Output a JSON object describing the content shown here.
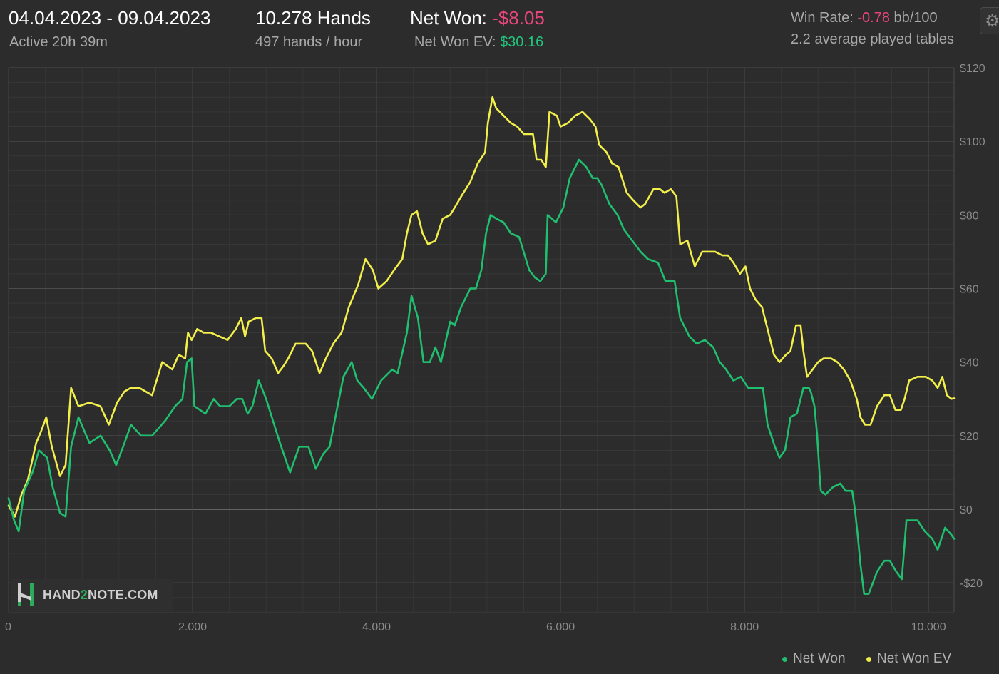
{
  "header": {
    "date_range": "04.04.2023 - 09.04.2023",
    "active": "Active 20h 39m",
    "hands_total": "10.278 Hands",
    "hands_rate": "497 hands / hour",
    "net_won_label": "Net Won: ",
    "net_won_value": "-$8.05",
    "net_won_ev_label": "Net Won  EV: ",
    "net_won_ev_value": "$30.16",
    "win_rate_label": "Win Rate: ",
    "win_rate_value": "-0.78",
    "win_rate_unit": " bb/100",
    "tables": "2.2 average played tables"
  },
  "settings_icon": "gear-icon",
  "logo": {
    "text_a": "HAND",
    "text_b": "2",
    "text_c": "NOTE.COM"
  },
  "colors": {
    "background": "#2c2c2c",
    "net_won": "#1fbf6f",
    "net_won_ev": "#f2ee4a",
    "negative": "#e8457a",
    "positive": "#22c57d",
    "grid": "#4a4a4a"
  },
  "chart_data": {
    "type": "line",
    "xlabel": "",
    "ylabel": "",
    "xlim": [
      0,
      10278
    ],
    "ylim": [
      -28,
      120
    ],
    "x_ticks": [
      0,
      2000,
      4000,
      6000,
      8000,
      10000
    ],
    "x_tick_labels": [
      "0",
      "2.000",
      "4.000",
      "6.000",
      "8.000",
      "10.000"
    ],
    "y_ticks": [
      120,
      100,
      80,
      60,
      40,
      20,
      0,
      -20
    ],
    "y_tick_labels": [
      "$120",
      "$100",
      "$80",
      "$60",
      "$40",
      "$20",
      "$0",
      "-$20"
    ],
    "grid": true,
    "legend_position": "bottom-right",
    "series": [
      {
        "name": "Net Won",
        "color": "#1fbf6f",
        "points": [
          [
            0,
            3
          ],
          [
            60,
            -3
          ],
          [
            110,
            -6
          ],
          [
            170,
            5
          ],
          [
            260,
            10
          ],
          [
            330,
            16
          ],
          [
            420,
            14
          ],
          [
            480,
            6
          ],
          [
            560,
            -1
          ],
          [
            620,
            -2
          ],
          [
            680,
            17
          ],
          [
            760,
            25
          ],
          [
            880,
            18
          ],
          [
            1000,
            20
          ],
          [
            1100,
            16
          ],
          [
            1170,
            12
          ],
          [
            1260,
            18
          ],
          [
            1330,
            23
          ],
          [
            1440,
            20
          ],
          [
            1560,
            20
          ],
          [
            1700,
            24
          ],
          [
            1810,
            28
          ],
          [
            1890,
            30
          ],
          [
            1940,
            40
          ],
          [
            1990,
            41
          ],
          [
            2020,
            28
          ],
          [
            2080,
            27
          ],
          [
            2140,
            26
          ],
          [
            2230,
            30
          ],
          [
            2300,
            28
          ],
          [
            2400,
            28
          ],
          [
            2480,
            30
          ],
          [
            2540,
            30
          ],
          [
            2600,
            26
          ],
          [
            2650,
            28
          ],
          [
            2720,
            35
          ],
          [
            2800,
            30
          ],
          [
            2900,
            22
          ],
          [
            2950,
            18
          ],
          [
            3060,
            10
          ],
          [
            3160,
            17
          ],
          [
            3260,
            17
          ],
          [
            3340,
            11
          ],
          [
            3420,
            15
          ],
          [
            3490,
            17
          ],
          [
            3560,
            26
          ],
          [
            3640,
            36
          ],
          [
            3730,
            40
          ],
          [
            3790,
            35
          ],
          [
            3860,
            33
          ],
          [
            3950,
            30
          ],
          [
            4050,
            35
          ],
          [
            4170,
            38
          ],
          [
            4230,
            37
          ],
          [
            4330,
            48
          ],
          [
            4380,
            58
          ],
          [
            4450,
            52
          ],
          [
            4510,
            40
          ],
          [
            4580,
            40
          ],
          [
            4640,
            44
          ],
          [
            4700,
            40
          ],
          [
            4800,
            51
          ],
          [
            4850,
            50
          ],
          [
            4920,
            55
          ],
          [
            5020,
            60
          ],
          [
            5080,
            60
          ],
          [
            5140,
            65
          ],
          [
            5190,
            75
          ],
          [
            5240,
            80
          ],
          [
            5300,
            79
          ],
          [
            5380,
            78
          ],
          [
            5460,
            75
          ],
          [
            5550,
            74
          ],
          [
            5660,
            65
          ],
          [
            5720,
            63
          ],
          [
            5780,
            62
          ],
          [
            5840,
            64
          ],
          [
            5860,
            80
          ],
          [
            5950,
            78
          ],
          [
            6030,
            82
          ],
          [
            6100,
            90
          ],
          [
            6200,
            95
          ],
          [
            6280,
            93
          ],
          [
            6350,
            90
          ],
          [
            6400,
            90
          ],
          [
            6450,
            88
          ],
          [
            6530,
            83
          ],
          [
            6620,
            80
          ],
          [
            6690,
            76
          ],
          [
            6780,
            73
          ],
          [
            6870,
            70
          ],
          [
            6950,
            68
          ],
          [
            7060,
            67
          ],
          [
            7140,
            62
          ],
          [
            7200,
            62
          ],
          [
            7240,
            62
          ],
          [
            7300,
            52
          ],
          [
            7400,
            47
          ],
          [
            7480,
            45
          ],
          [
            7570,
            46
          ],
          [
            7660,
            44
          ],
          [
            7730,
            40
          ],
          [
            7800,
            38
          ],
          [
            7880,
            35
          ],
          [
            7960,
            36
          ],
          [
            8040,
            33
          ],
          [
            8090,
            33
          ],
          [
            8150,
            33
          ],
          [
            8200,
            33
          ],
          [
            8250,
            23
          ],
          [
            8330,
            17
          ],
          [
            8380,
            14
          ],
          [
            8440,
            16
          ],
          [
            8500,
            25
          ],
          [
            8570,
            26
          ],
          [
            8640,
            33
          ],
          [
            8700,
            33
          ],
          [
            8720,
            32
          ],
          [
            8760,
            28
          ],
          [
            8790,
            20
          ],
          [
            8800,
            16
          ],
          [
            8810,
            12
          ],
          [
            8820,
            8
          ],
          [
            8830,
            5
          ],
          [
            8880,
            4
          ],
          [
            8960,
            6
          ],
          [
            9040,
            7
          ],
          [
            9100,
            5
          ],
          [
            9170,
            5
          ],
          [
            9200,
            0
          ],
          [
            9230,
            -7
          ],
          [
            9260,
            -15
          ],
          [
            9300,
            -23
          ],
          [
            9350,
            -23
          ],
          [
            9440,
            -17
          ],
          [
            9520,
            -14
          ],
          [
            9580,
            -14
          ],
          [
            9650,
            -17
          ],
          [
            9710,
            -19
          ],
          [
            9760,
            -3
          ],
          [
            9800,
            -3
          ],
          [
            9880,
            -3
          ],
          [
            9960,
            -6
          ],
          [
            10040,
            -8
          ],
          [
            10100,
            -11
          ],
          [
            10180,
            -5
          ],
          [
            10250,
            -7
          ],
          [
            10278,
            -8.05
          ]
        ]
      },
      {
        "name": "Net Won  EV",
        "color": "#f2ee4a",
        "points": [
          [
            0,
            1
          ],
          [
            70,
            -2
          ],
          [
            140,
            4
          ],
          [
            210,
            8
          ],
          [
            300,
            18
          ],
          [
            350,
            21
          ],
          [
            410,
            25
          ],
          [
            470,
            17
          ],
          [
            560,
            9
          ],
          [
            620,
            12
          ],
          [
            680,
            33
          ],
          [
            760,
            28
          ],
          [
            880,
            29
          ],
          [
            1000,
            28
          ],
          [
            1090,
            23
          ],
          [
            1180,
            29
          ],
          [
            1260,
            32
          ],
          [
            1330,
            33
          ],
          [
            1420,
            33
          ],
          [
            1560,
            31
          ],
          [
            1670,
            40
          ],
          [
            1780,
            38
          ],
          [
            1850,
            42
          ],
          [
            1920,
            41
          ],
          [
            1950,
            48
          ],
          [
            1990,
            46
          ],
          [
            2050,
            49
          ],
          [
            2120,
            48
          ],
          [
            2200,
            48
          ],
          [
            2290,
            47
          ],
          [
            2380,
            46
          ],
          [
            2470,
            49
          ],
          [
            2530,
            52
          ],
          [
            2570,
            47
          ],
          [
            2610,
            51
          ],
          [
            2690,
            52
          ],
          [
            2750,
            52
          ],
          [
            2790,
            43
          ],
          [
            2860,
            41
          ],
          [
            2930,
            37
          ],
          [
            2990,
            39
          ],
          [
            3040,
            41
          ],
          [
            3120,
            45
          ],
          [
            3230,
            45
          ],
          [
            3300,
            43
          ],
          [
            3380,
            37
          ],
          [
            3450,
            41
          ],
          [
            3530,
            45
          ],
          [
            3620,
            48
          ],
          [
            3700,
            55
          ],
          [
            3800,
            61
          ],
          [
            3880,
            68
          ],
          [
            3960,
            65
          ],
          [
            4020,
            60
          ],
          [
            4110,
            62
          ],
          [
            4190,
            65
          ],
          [
            4280,
            68
          ],
          [
            4330,
            75
          ],
          [
            4380,
            80
          ],
          [
            4440,
            81
          ],
          [
            4500,
            75
          ],
          [
            4560,
            72
          ],
          [
            4640,
            73
          ],
          [
            4720,
            79
          ],
          [
            4800,
            80
          ],
          [
            4850,
            82
          ],
          [
            4920,
            85
          ],
          [
            5020,
            89
          ],
          [
            5100,
            94
          ],
          [
            5180,
            97
          ],
          [
            5210,
            105
          ],
          [
            5260,
            112
          ],
          [
            5300,
            109
          ],
          [
            5380,
            107
          ],
          [
            5460,
            105
          ],
          [
            5530,
            104
          ],
          [
            5600,
            102
          ],
          [
            5700,
            102
          ],
          [
            5740,
            95
          ],
          [
            5790,
            95
          ],
          [
            5840,
            93
          ],
          [
            5880,
            108
          ],
          [
            5960,
            107
          ],
          [
            6000,
            104
          ],
          [
            6080,
            105
          ],
          [
            6160,
            107
          ],
          [
            6240,
            108
          ],
          [
            6320,
            106
          ],
          [
            6380,
            104
          ],
          [
            6420,
            99
          ],
          [
            6500,
            97
          ],
          [
            6560,
            94
          ],
          [
            6630,
            93
          ],
          [
            6720,
            86
          ],
          [
            6790,
            84
          ],
          [
            6870,
            82
          ],
          [
            6920,
            83
          ],
          [
            7010,
            87
          ],
          [
            7080,
            87
          ],
          [
            7130,
            86
          ],
          [
            7200,
            87
          ],
          [
            7260,
            85
          ],
          [
            7300,
            72
          ],
          [
            7380,
            73
          ],
          [
            7460,
            66
          ],
          [
            7540,
            70
          ],
          [
            7600,
            70
          ],
          [
            7680,
            70
          ],
          [
            7760,
            69
          ],
          [
            7820,
            69
          ],
          [
            7880,
            67
          ],
          [
            7950,
            64
          ],
          [
            8010,
            66
          ],
          [
            8060,
            60
          ],
          [
            8120,
            57
          ],
          [
            8190,
            55
          ],
          [
            8260,
            48
          ],
          [
            8320,
            42
          ],
          [
            8380,
            40
          ],
          [
            8450,
            42
          ],
          [
            8500,
            43
          ],
          [
            8560,
            50
          ],
          [
            8610,
            50
          ],
          [
            8640,
            43
          ],
          [
            8680,
            36
          ],
          [
            8740,
            38
          ],
          [
            8800,
            40
          ],
          [
            8860,
            41
          ],
          [
            8940,
            41
          ],
          [
            9010,
            40
          ],
          [
            9080,
            38
          ],
          [
            9150,
            35
          ],
          [
            9220,
            30
          ],
          [
            9260,
            25
          ],
          [
            9310,
            23
          ],
          [
            9370,
            23
          ],
          [
            9440,
            28
          ],
          [
            9520,
            31
          ],
          [
            9580,
            31
          ],
          [
            9640,
            27
          ],
          [
            9700,
            27
          ],
          [
            9740,
            30
          ],
          [
            9790,
            35
          ],
          [
            9880,
            36
          ],
          [
            9970,
            36
          ],
          [
            10040,
            35
          ],
          [
            10100,
            33
          ],
          [
            10150,
            36
          ],
          [
            10200,
            31
          ],
          [
            10250,
            30
          ],
          [
            10278,
            30.16
          ]
        ]
      }
    ]
  },
  "legend": {
    "net_won": "Net Won",
    "net_won_ev": "Net Won  EV"
  }
}
